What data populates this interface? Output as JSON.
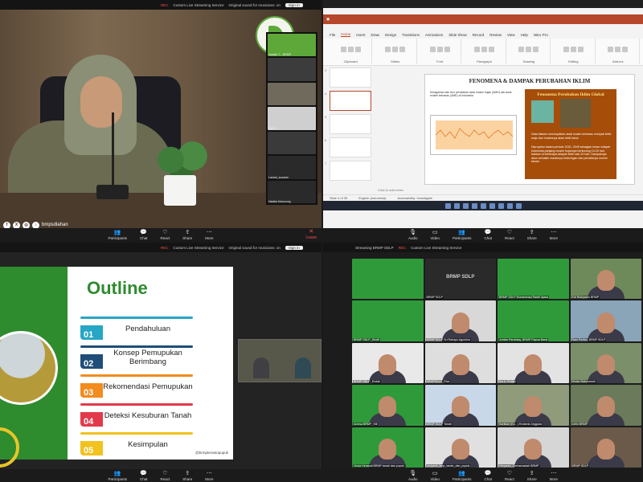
{
  "zoom": {
    "participants": "Participants",
    "chat": "Chat",
    "react": "React",
    "share": "Share",
    "more": "More",
    "leave": "Leave",
    "audio": "Audio",
    "video": "Video",
    "rec_badge": "REC",
    "live_title": "Custom Live Streaming Service",
    "sound_tip": "Original sound for musicians: on",
    "signin": "Sign in"
  },
  "q1": {
    "social_handle": "bmpsdlahan",
    "social_icons": [
      "facebook-icon",
      "x-icon",
      "instagram-icon",
      "tiktok-icon"
    ],
    "gallery": [
      {
        "name": "Jasdah T. - BRMP",
        "color": "#5ea83a"
      },
      {
        "name": "",
        "color": "#3c3c3c"
      },
      {
        "name": "",
        "color": "#6f6a5c"
      },
      {
        "name": "Dalil S.",
        "color": "#cfcfcf"
      },
      {
        "name": "",
        "color": "#3a3a3a"
      },
      {
        "name": "Lamah_susanto",
        "color": "#2a2a2a"
      },
      {
        "name": "Natalia Manurung",
        "color": "#2a2a2a"
      }
    ]
  },
  "q2": {
    "menus": [
      "File",
      "Home",
      "Insert",
      "Draw",
      "Design",
      "Transitions",
      "Animations",
      "Slide Show",
      "Record",
      "Review",
      "View",
      "Help",
      "Nitro Pro"
    ],
    "active_menu": "Home",
    "ribbon_groups": [
      "Clipboard",
      "Slides",
      "Font",
      "Paragraph",
      "Drawing",
      "Editing",
      "Add-ins"
    ],
    "buttons": {
      "record": "Record",
      "present": "Present in Teams"
    },
    "slide_title": "FENOMENA & DAMPAK PERUBAHAN IKLIM",
    "panel_title": "Fenomena Perubahan Iklim Global",
    "caption": "Keragaman dan tren perubahan awal musim hujan (AMH) dan awal musim kemarau (AMK) di Indonesia",
    "bullets": [
      "Data historis menunjukkan awal musim kemarau menjadi lebih maju dan musimnya akan lebih lama.",
      "Diproyeksi dalam periode 2030- 2049 sebagian besar wilayah Indonesia panjang musim hujannya berkurang 10-20 hari, bahkan di beberapa wilayah lebih dari 20 hari. Dampaknya akan semakin maraknya kekeringan dan pendeknya musim tanam."
    ],
    "notes": "Click to add notes",
    "status": [
      "Slide 4 of 35",
      "English (Indonesia)",
      "Accessibility: Investigate"
    ],
    "slide_numbers": [
      "3",
      "4",
      "5",
      "6",
      "7"
    ]
  },
  "q3": {
    "title": "Outline",
    "items": [
      {
        "num": "01",
        "label": "Pendahuluan",
        "color": "#27a6c6"
      },
      {
        "num": "02",
        "label": "Konsep Pemupukan Berimbang",
        "color": "#1f4e79"
      },
      {
        "num": "03",
        "label": "Rekomendasi Pemupukan",
        "color": "#f28c1e"
      },
      {
        "num": "04",
        "label": "Deteksi Kesuburan Tanah",
        "color": "#e23a4a"
      },
      {
        "num": "05",
        "label": "Kesimpulan",
        "color": "#f2c21e"
      }
    ],
    "footer": "@brmpterastopupuk"
  },
  "q4": {
    "window_title": "Streaming BRMP SDLP",
    "tiles": [
      {
        "name": "",
        "bg": "#2f9a3a",
        "type": "logo"
      },
      {
        "name": "BRMP SDLP",
        "bg": "#2a2a2a",
        "type": "label"
      },
      {
        "name": "BRMP SDLP Muhammad Rafail Ilyasa",
        "bg": "#2f9a3a",
        "type": "logo"
      },
      {
        "name": "Edi Rubiyanto BRMP",
        "bg": "#6f8a5a",
        "type": "person"
      },
      {
        "name": "BRMP SDLP_Shoffi",
        "bg": "#2f9a3a",
        "type": "logo"
      },
      {
        "name": "BRMP SDLP Sri Rahayu Agustina",
        "bg": "#d8d8d8",
        "type": "person"
      },
      {
        "name": "Jordan Pardosay, BRMP Papua Barat",
        "bg": "#2f9a3a",
        "type": "logo"
      },
      {
        "name": "Rani Pertiwi, BRMP SDLP",
        "bg": "#8aa4b8",
        "type": "person"
      },
      {
        "name": "BRMP SDLP_Endah",
        "bg": "#e9e9e9",
        "type": "person"
      },
      {
        "name": "BRMPSDLP_Elsa",
        "bg": "#dedede",
        "type": "person"
      },
      {
        "name": "Ika A. Pratiwi",
        "bg": "#e3e3e3",
        "type": "person"
      },
      {
        "name": "Wulan Rahmawati",
        "bg": "#7a8f6a",
        "type": "person"
      },
      {
        "name": "Annisa BRMP_Siti",
        "bg": "#2f9a3a",
        "type": "person"
      },
      {
        "name": "BRMP SDLP Tanah",
        "bg": "#c8d8e8",
        "type": "person"
      },
      {
        "name": "Kartikan (Ku...) Endarda Jegguka",
        "bg": "#8f9b7a",
        "type": "person"
      },
      {
        "name": "Arifin BRMP",
        "bg": "#6a7a5a",
        "type": "person"
      },
      {
        "name": "Vinda Herasati BRMP tanah dan pupuk",
        "bg": "#2f9a3a",
        "type": "person"
      },
      {
        "name": "Umiyanti_bmp_tanah_dan_pupuk",
        "bg": "#e0e0e0",
        "type": "person"
      },
      {
        "name": "Heryanto_Cerhamastah BRMP",
        "bg": "#d6d6d6",
        "type": "person"
      },
      {
        "name": "BRMP SDLP",
        "bg": "#6b5a4a",
        "type": "person"
      }
    ]
  }
}
